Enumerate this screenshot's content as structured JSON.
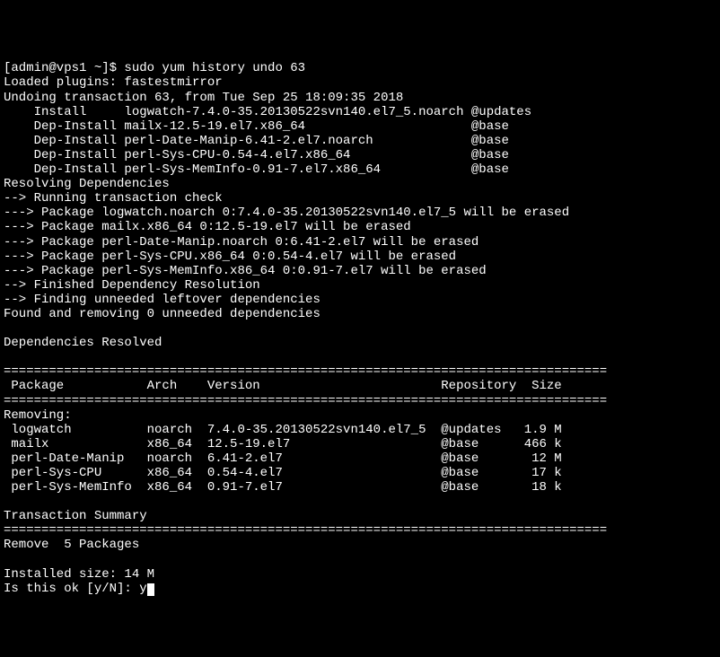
{
  "prompt": "[admin@vps1 ~]$ sudo yum history undo 63",
  "lines": [
    "Loaded plugins: fastestmirror",
    "Undoing transaction 63, from Tue Sep 25 18:09:35 2018",
    "    Install     logwatch-7.4.0-35.20130522svn140.el7_5.noarch @updates",
    "    Dep-Install mailx-12.5-19.el7.x86_64                      @base",
    "    Dep-Install perl-Date-Manip-6.41-2.el7.noarch             @base",
    "    Dep-Install perl-Sys-CPU-0.54-4.el7.x86_64                @base",
    "    Dep-Install perl-Sys-MemInfo-0.91-7.el7.x86_64            @base",
    "Resolving Dependencies",
    "--> Running transaction check",
    "---> Package logwatch.noarch 0:7.4.0-35.20130522svn140.el7_5 will be erased",
    "---> Package mailx.x86_64 0:12.5-19.el7 will be erased",
    "---> Package perl-Date-Manip.noarch 0:6.41-2.el7 will be erased",
    "---> Package perl-Sys-CPU.x86_64 0:0.54-4.el7 will be erased",
    "---> Package perl-Sys-MemInfo.x86_64 0:0.91-7.el7 will be erased",
    "--> Finished Dependency Resolution",
    "--> Finding unneeded leftover dependencies",
    "Found and removing 0 unneeded dependencies",
    "",
    "Dependencies Resolved",
    ""
  ],
  "sep": "================================================================================",
  "header": " Package           Arch    Version                        Repository  Size",
  "removing_label": "Removing:",
  "rows": [
    " logwatch          noarch  7.4.0-35.20130522svn140.el7_5  @updates   1.9 M",
    " mailx             x86_64  12.5-19.el7                    @base      466 k",
    " perl-Date-Manip   noarch  6.41-2.el7                     @base       12 M",
    " perl-Sys-CPU      x86_64  0.54-4.el7                     @base       17 k",
    " perl-Sys-MemInfo  x86_64  0.91-7.el7                     @base       18 k"
  ],
  "txn_summary": "Transaction Summary",
  "remove_line": "Remove  5 Packages",
  "installed_size": "Installed size: 14 M",
  "confirm": "Is this ok [y/N]: y",
  "chart_data": {
    "type": "table",
    "title": "Dependencies Resolved - Removing",
    "columns": [
      "Package",
      "Arch",
      "Version",
      "Repository",
      "Size"
    ],
    "rows": [
      [
        "logwatch",
        "noarch",
        "7.4.0-35.20130522svn140.el7_5",
        "@updates",
        "1.9 M"
      ],
      [
        "mailx",
        "x86_64",
        "12.5-19.el7",
        "@base",
        "466 k"
      ],
      [
        "perl-Date-Manip",
        "noarch",
        "6.41-2.el7",
        "@base",
        "12 M"
      ],
      [
        "perl-Sys-CPU",
        "x86_64",
        "0.54-4.el7",
        "@base",
        "17 k"
      ],
      [
        "perl-Sys-MemInfo",
        "x86_64",
        "0.91-7.el7",
        "@base",
        "18 k"
      ]
    ],
    "summary": {
      "remove_count": 5,
      "installed_size": "14 M"
    }
  }
}
